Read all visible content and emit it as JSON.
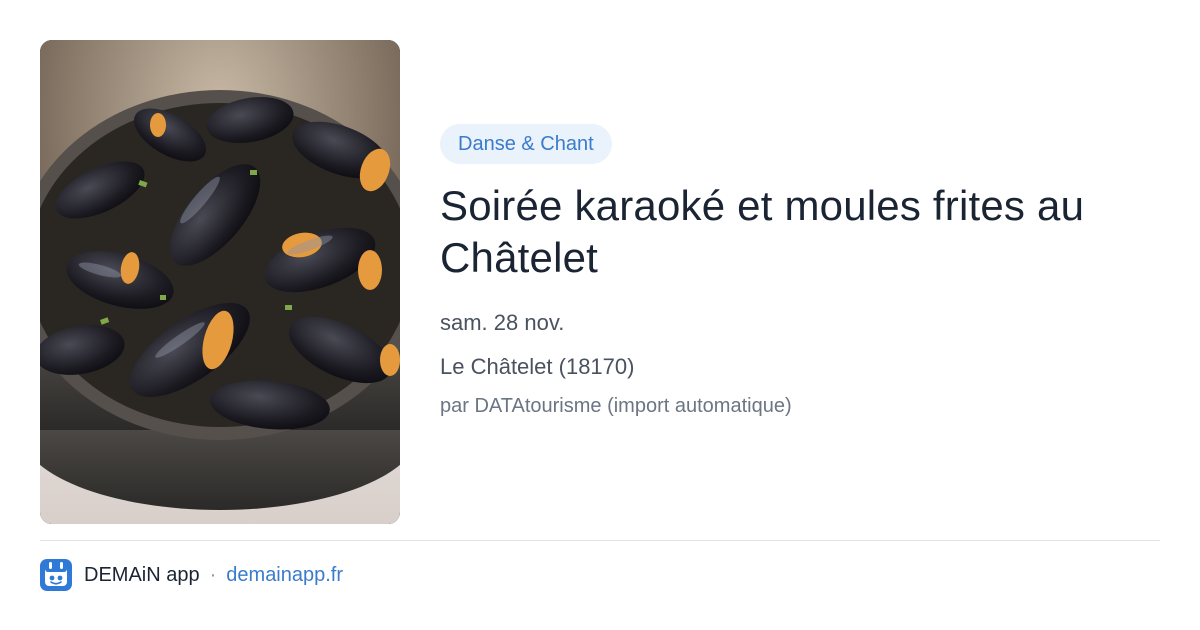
{
  "card": {
    "image": {
      "alt_icon": "mussels-photo",
      "subject": "pot of steamed mussels"
    },
    "category": "Danse & Chant",
    "title": "Soirée karaoké et moules frites au Châtelet",
    "date": "sam. 28 nov.",
    "location": "Le Châtelet (18170)",
    "source": "par DATAtourisme (import automatique)"
  },
  "footer": {
    "logo_icon": "demain-app-logo-icon",
    "app_name": "DEMAiN app",
    "separator": "·",
    "link": "demainapp.fr"
  },
  "colors": {
    "badge_bg": "#eaf2fb",
    "badge_text": "#3a7bcb",
    "title": "#1a2433",
    "meta": "#4a5260",
    "source": "#6b7583",
    "link": "#3a7bcb",
    "divider": "#dfe5ea"
  }
}
